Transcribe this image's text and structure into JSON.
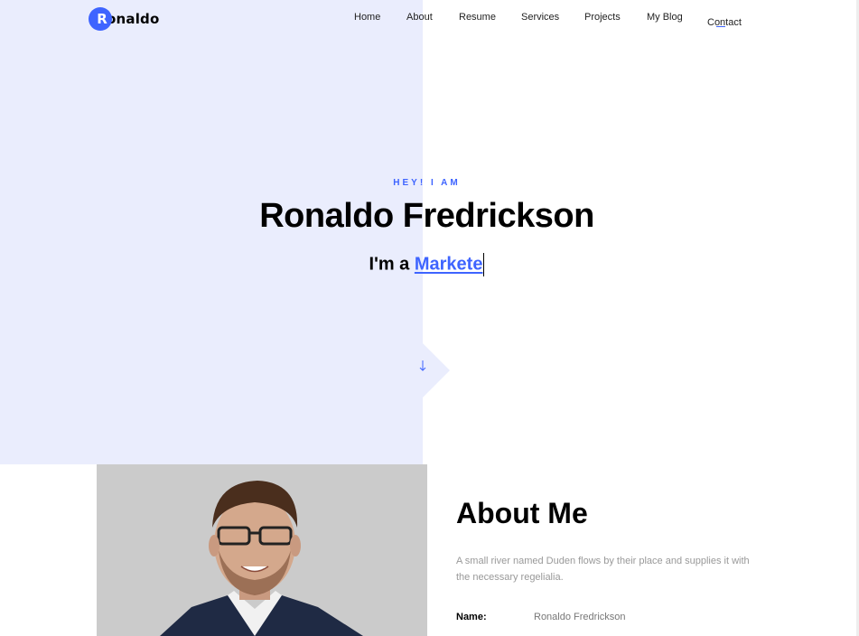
{
  "brand": {
    "logo_initial": "R",
    "logo_rest": "onaldo"
  },
  "nav": {
    "items": [
      {
        "label": "Home"
      },
      {
        "label": "About"
      },
      {
        "label": "Resume"
      },
      {
        "label": "Services"
      },
      {
        "label": "Projects"
      },
      {
        "label": "My Blog"
      },
      {
        "label": "Contact",
        "active": true
      }
    ]
  },
  "hero": {
    "kicker": "HEY! I AM",
    "name": "Ronaldo Fredrickson",
    "sub_prefix": "I'm a ",
    "sub_typed": "Markete",
    "scroll_icon": "arrow-down-icon"
  },
  "about": {
    "title": "About Me",
    "description": "A small river named Duden flows by their place and supplies it with the necessary regelialia.",
    "info": [
      {
        "label": "Name:",
        "value": "Ronaldo Fredrickson"
      }
    ]
  },
  "colors": {
    "accent": "#3e64ff",
    "hero_bg": "#eaedfd"
  }
}
